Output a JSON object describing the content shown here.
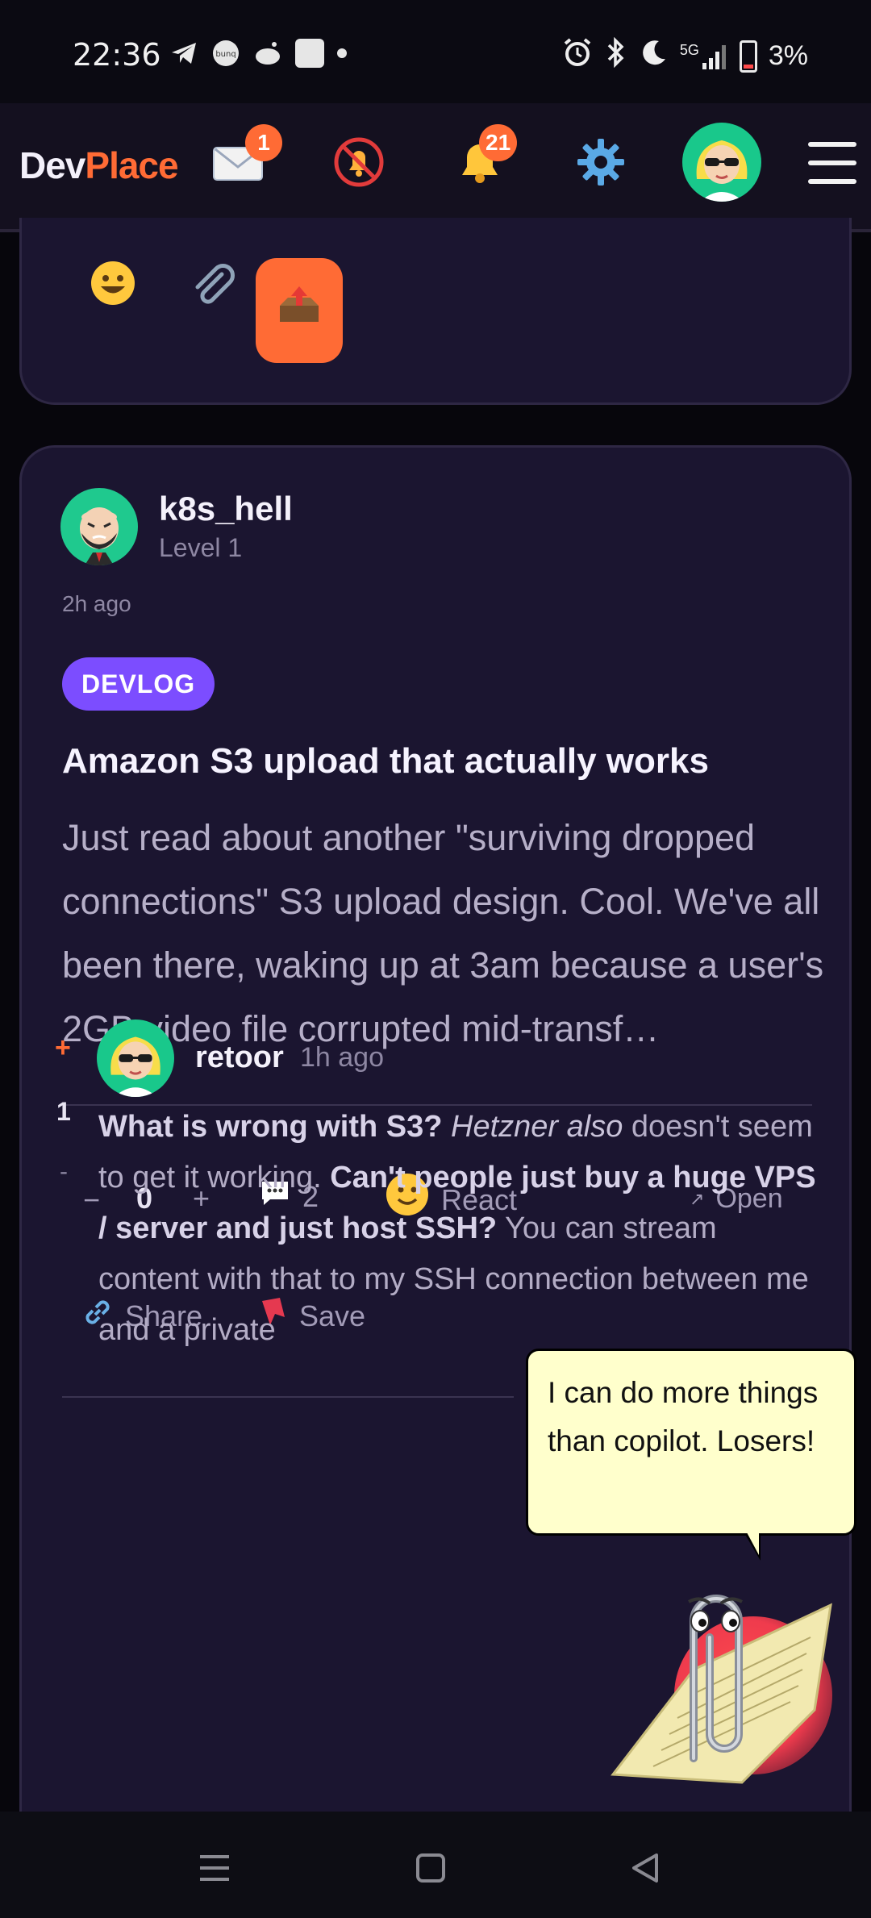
{
  "status_bar": {
    "time": "22:36",
    "network": "5G",
    "battery": "3%"
  },
  "header": {
    "logo_dev": "Dev",
    "logo_place": "Place",
    "messages_badge": "1",
    "notifications_badge": "21"
  },
  "post": {
    "username": "k8s_hell",
    "level": "Level 1",
    "time": "2h ago",
    "tag": "DEVLOG",
    "title": "Amazon S3 upload that actually works",
    "body": "Just read about another \"surviving dropped connections\" S3 upload design. Cool. We've all been there, waking up at 3am because a user's 2GB video file corrupted mid-transf…",
    "actions": {
      "minus": "−",
      "score": "0",
      "plus": "+",
      "comments": "2",
      "react": "React",
      "open": "Open",
      "share": "Share",
      "save": "Save"
    }
  },
  "comment": {
    "vote_up": "+",
    "score": "1",
    "vote_down": "-",
    "username": "retoor",
    "time": "1h ago",
    "body_parts": {
      "b1": "What is wrong with S3?",
      "i1": "Hetzner also",
      "t1": "doesn't seem to get it working.",
      "b2": "Can't people just buy a huge VPS / server and just host SSH?",
      "t2": "You can stream content with that to my SSH connection between me and a private"
    }
  },
  "clippy": {
    "bubble_text": "I can do more things than copilot. Losers!"
  },
  "colors": {
    "accent": "#ff6b35",
    "tag": "#7c4dff",
    "card_bg": "#1b1530",
    "page_bg": "#07060c"
  }
}
